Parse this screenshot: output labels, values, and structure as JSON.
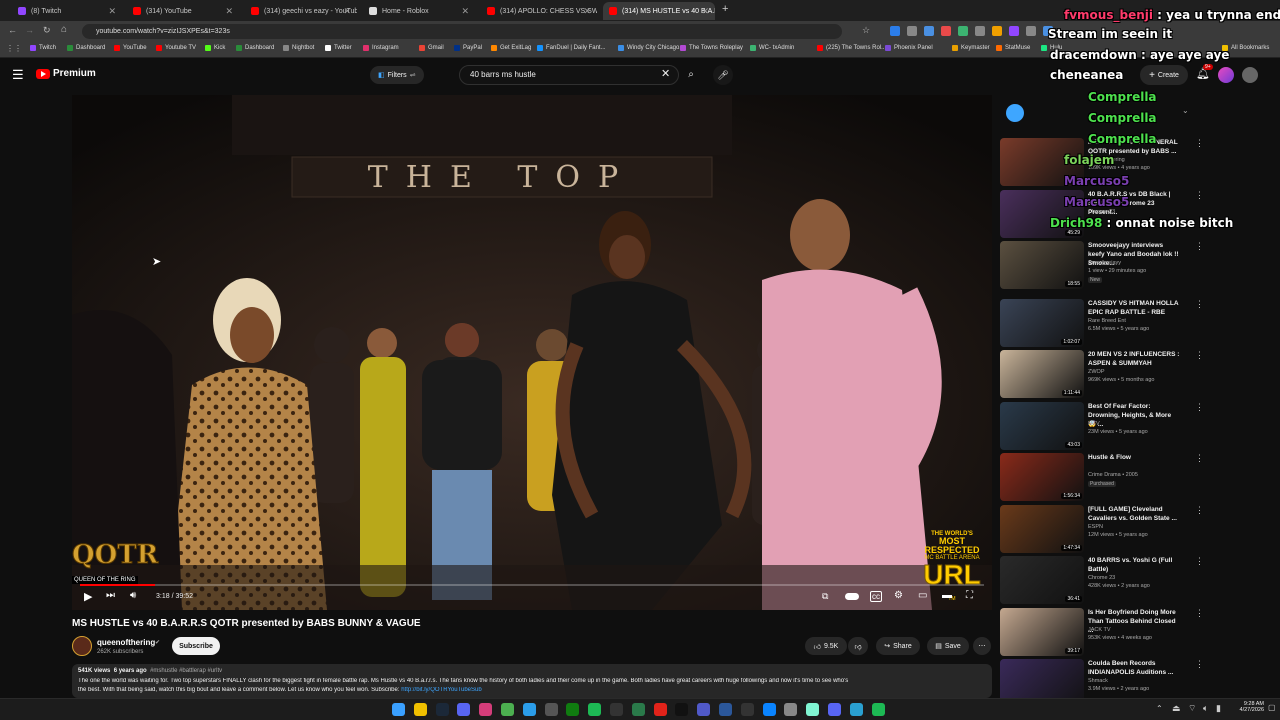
{
  "tabs": [
    {
      "label": "(8) Twitch",
      "color": "#9146ff"
    },
    {
      "label": "(314) YouTube",
      "color": "#ff0000"
    },
    {
      "label": "(314) geechi vs eazy - YouTube",
      "color": "#ff0000"
    },
    {
      "label": "Home - Roblox",
      "color": "#dddddd"
    },
    {
      "label": "(314) APOLLO: CHESS VS SWAN",
      "color": "#ff0000"
    },
    {
      "label": "(314) MS HUSTLE vs 40 B.A.R.R",
      "color": "#ff0000"
    }
  ],
  "url": "youtube.com/watch?v=zizIJSXPEs&t=323s",
  "bookmarks": [
    "Twitch",
    "Dashboard",
    "YouTube",
    "Youtube TV",
    "Kick",
    "Dashboard",
    "Nightbot",
    "Twitter",
    "Instagram",
    "Gmail",
    "PayPal",
    "Get ExitLag",
    "FanDuel | Daily Fant...",
    "Windy City Chicago...",
    "The Towns Roleplay",
    "WC- txAdmin",
    "(225) The Towns Rol...",
    "Phoenix Panel",
    "Keymaster",
    "StatMuse",
    "Hulu",
    "All Bookmarks"
  ],
  "masthead": {
    "logo": "Premium",
    "filters": "Filters",
    "search_value": "40 barrs ms hustle",
    "create": "Create",
    "notif_count": "9+"
  },
  "player": {
    "time": "3:18 / 39:52",
    "progress": 0.083,
    "sign_text": "THE TOP",
    "brand_left": "QOTR",
    "brand_left_sub": "QUEEN OF THE RING",
    "brand_right_top": "THE WORLD'S",
    "brand_right_mid": "MOST RESPECTED",
    "brand_right_sub": "MC BATTLE ARENA",
    "brand_right_big": "URL",
    "brand_right_tag": "TM"
  },
  "video": {
    "title": "MS HUSTLE vs 40 B.A.R.R.S QOTR presented by BABS BUNNY & VAGUE",
    "channel": "queenofthering",
    "subs": "262K subscribers",
    "subscribe": "Subscribe",
    "likes": "9.5K",
    "share": "Share",
    "save": "Save",
    "views": "541K views",
    "age": "6 years ago",
    "tags": "#mshustle #battlerap #urltv",
    "desc1": "The one the world was waiting for. Two top superstars FINALLY clash for the biggest fight in female battle rap. Ms Hustle vs 40 B.a.r.r.s. The fans know the history of both ladies and their come up in the game. Both ladies have great careers with huge followings and now it's time to see who's",
    "desc2": "the best. With that being said, watch this big bout and leave a comment below. Let us know who you feel won. Subscribe:",
    "desc_link": "http://bit.ly/QOTRYouTubeSub"
  },
  "recs": [
    {
      "title": "MS. FIT vs PHARA FUNERAL QOTR presented by BABS ...",
      "channel": "queenofthering",
      "meta": "109K views • 4 years ago",
      "dur": "",
      "color": "#7a3b2a"
    },
    {
      "title": "40 B.A.R.R.S vs DB Black | Sandbox | Chrome 23 Present...",
      "channel": "Chrome 23",
      "meta": "",
      "dur": "45:29",
      "color": "#4a2f5c"
    },
    {
      "title": "Smooveejayy interviews keefy Yano and Boodah lok !! Smoke...",
      "channel": "Smooveejayy",
      "meta": "1 view • 29 minutes ago",
      "dur": "18:55",
      "badge": "New",
      "color": "#5b5040"
    },
    {
      "title": "CASSIDY VS HITMAN HOLLA EPIC RAP BATTLE - RBE",
      "channel": "Rare Breed Ent",
      "meta": "6.5M views • 5 years ago",
      "dur": "1:02:07",
      "color": "#3a4456"
    },
    {
      "title": "20 MEN VS 2 INFLUENCERS : ASPEN & SUMMYAH",
      "channel": "ZWOP",
      "meta": "969K views • 5 months ago",
      "dur": "1:11:44",
      "color": "#c9b49a"
    },
    {
      "title": "Best Of Fear Factor: Drowning, Heights, & More 🤯 ...",
      "channel": "MTV",
      "meta": "23M views • 5 years ago",
      "dur": "43:03",
      "color": "#2a3a4a"
    },
    {
      "title": "Hustle & Flow",
      "channel": "Crime Drama • 2005",
      "meta": "",
      "dur": "1:56:34",
      "badge": "Purchased",
      "color": "#8a2a1a"
    },
    {
      "title": "[FULL GAME] Cleveland Cavaliers vs. Golden State ...",
      "channel": "ESPN",
      "meta": "12M views • 5 years ago",
      "dur": "1:47:34",
      "color": "#6a3a1a"
    },
    {
      "title": "40 BARRS vs. Yoshi G (Full Battle)",
      "channel": "Chrome 23",
      "meta": "428K views • 2 years ago",
      "dur": "36:41",
      "color": "#2a2a2a"
    },
    {
      "title": "Is Her Boyfriend Doing More Than Tattoos Behind Closed ...",
      "channel": "JACK TV",
      "meta": "953K views • 4 weeks ago",
      "dur": "39:17",
      "color": "#c4a890"
    },
    {
      "title": "Coulda Been Records INDIANAPOLIS Auditions ...",
      "channel": "Shmack",
      "meta": "3.9M views • 2 years ago",
      "dur": "",
      "color": "#3a2a5a"
    }
  ],
  "chat": [
    {
      "user": "fvmous_benji",
      "msg": "yea u trynna end",
      "color": "#ff3b6b"
    },
    {
      "user": "",
      "msg": "Stream im seein it",
      "color": "#ffffff"
    },
    {
      "user": "dracemdown",
      "msg": "aye aye aye",
      "color": "#ffffff"
    },
    {
      "user": "cheneanea",
      "msg": "",
      "color": "#ffffff"
    },
    {
      "user": "Comprella",
      "msg": "",
      "color": "#4de04d"
    },
    {
      "user": "Comprella",
      "msg": "",
      "color": "#4de04d"
    },
    {
      "user": "Comprella",
      "msg": "",
      "color": "#4de04d"
    },
    {
      "user": "folajem",
      "msg": "",
      "color": "#7bd35a"
    },
    {
      "user": "Marcuso5",
      "msg": "",
      "color": "#7a3fb0"
    },
    {
      "user": "Marcuso5",
      "msg": "",
      "color": "#7a3fb0"
    },
    {
      "user": "Drich98",
      "msg": "onnat noise bitch",
      "color": "#4de04d"
    }
  ],
  "clock": {
    "time": "9:28 AM",
    "date": "4/27/2026"
  }
}
